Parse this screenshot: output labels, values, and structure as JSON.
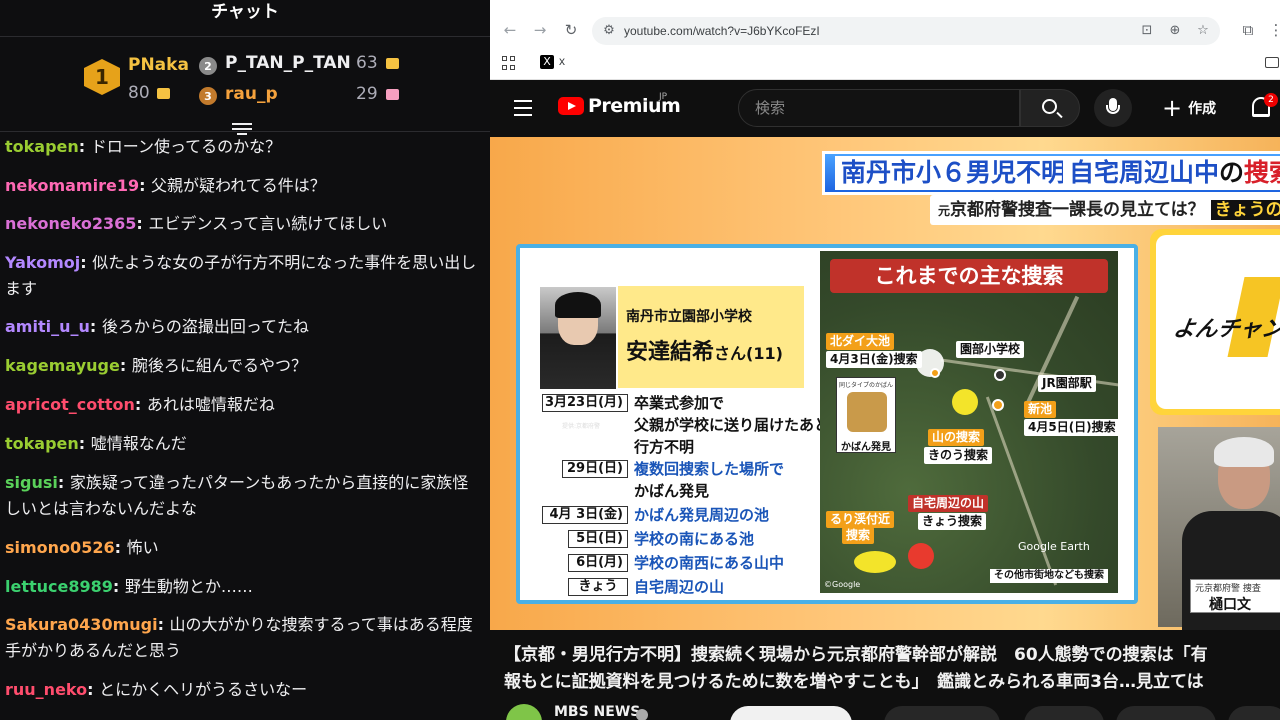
{
  "chat": {
    "title": "チャット",
    "gifters": [
      {
        "rank": "1",
        "name": "PNaka",
        "count": "80"
      },
      {
        "rank": "2",
        "name": "P_TAN_P_TAN",
        "count": "63"
      },
      {
        "rank": "3",
        "name": "rau_p",
        "count": "29"
      }
    ],
    "messages": [
      {
        "user": "tokapen",
        "color": "#9acd32",
        "text": "ドローン使ってるのかな？"
      },
      {
        "user": "nekomamire19",
        "color": "#ff69b4",
        "text": "父親が疑われてる件は？"
      },
      {
        "user": "nekoneko2365",
        "color": "#da70d6",
        "text": "エビデンスって言い続けてほしい"
      },
      {
        "user": "Yakomoj",
        "color": "#b388ff",
        "text": "似たような女の子が行方不明になった事件を思い出します"
      },
      {
        "user": "amiti_u_u",
        "color": "#b388ff",
        "text": "後ろからの盗撮出回ってたね"
      },
      {
        "user": "kagemayuge",
        "color": "#9acd32",
        "text": "腕後ろに組んでるやつ？"
      },
      {
        "user": "apricot_cotton",
        "color": "#ff4d6d",
        "text": "あれは嘘情報だね"
      },
      {
        "user": "tokapen",
        "color": "#9acd32",
        "text": "嘘情報なんだ"
      },
      {
        "user": "sigusi",
        "color": "#5ad15a",
        "text": "家族疑って違ったパターンもあったから直接的に家族怪しいとは言わないんだよな"
      },
      {
        "user": "simono0526",
        "color": "#ffa64d",
        "text": "怖い"
      },
      {
        "user": "lettuce8989",
        "color": "#3bd16f",
        "text": "野生動物とか……"
      },
      {
        "user": "Sakura0430mugi",
        "color": "#ffa64d",
        "text": "山の大がかりな捜索するって事はある程度 手がかりあるんだと思う"
      },
      {
        "user": "ruu_neko",
        "color": "#ff4d6d",
        "text": "とにかくヘリがうるさいなー"
      }
    ]
  },
  "browser": {
    "url": "youtube.com/watch?v=J6bYKcoFEzI",
    "bookmark_label": "x",
    "search_placeholder": "検索",
    "logo_text": "Premium",
    "logo_region": "JP",
    "create_label": "作成",
    "notification_count": "2"
  },
  "video": {
    "headline_main": "南丹市小６男児不明",
    "headline_sub": "自宅周辺山中",
    "headline_particle": "の",
    "headline_red": "捜索",
    "subhead_prefix": "元",
    "subhead": "京都府警捜査一課長の見立ては？",
    "subhead_tag": "きょうの",
    "school": "南丹市立園部小学校",
    "person_name": "安達結希",
    "person_suffix": "さん(11)",
    "photo_caption": "提供:京都府警",
    "timeline": [
      {
        "date": "3月23日(月)",
        "lines": [
          "卒業式参加で",
          "父親が学校に送り届けたあと",
          "行方不明"
        ]
      },
      {
        "date": "29日(日)",
        "lines": [
          "複数回捜索した場所で",
          "かばん発見"
        ]
      },
      {
        "date": "4月 3日(金)",
        "lines": [
          "かばん発見周辺の池"
        ]
      },
      {
        "date": "5日(日)",
        "lines": [
          "学校の南にある池"
        ]
      },
      {
        "date": "6日(月)",
        "lines": [
          "学校の南西にある山中"
        ]
      },
      {
        "date": "きょう",
        "lines": [
          "自宅周辺の山"
        ]
      }
    ],
    "map_title": "これまでの主な捜索",
    "map_labels": {
      "north_pond": "北ダイ大池",
      "north_pond_date": "4月3日(金)捜索",
      "school": "園部小学校",
      "station": "JR園部駅",
      "new_pond": "新池",
      "new_pond_date": "4月5日(日)捜索",
      "bag_caption": "同じタイプのかばん",
      "bag_found": "かばん発見",
      "mountain": "山の捜索",
      "mountain_when": "きのう捜索",
      "home_mountain": "自宅周辺の山",
      "home_when": "きょう捜索",
      "ruri": "るり渓付近",
      "ruri_when": "捜索",
      "credit": "Google Earth",
      "credit2": "©Google",
      "note": "その他市街地なども捜索"
    },
    "side_logo": "よんチャン",
    "expert_role": "元京都府警 捜査",
    "expert_name": "樋口文"
  },
  "meta": {
    "title_line1": "【京都・男児行方不明】捜索続く現場から元京都府警幹部が解説　60人態勢での捜索は「有",
    "title_line2": "報もとに証拠資料を見つけるために数を増やすことも」　鑑識とみられる車両3台…見立ては",
    "channel": "MBS NEWS"
  },
  "colors": {
    "accent": "#ff0000",
    "map_title": "#c0322a",
    "timeline_blue": "#1a55b8"
  }
}
